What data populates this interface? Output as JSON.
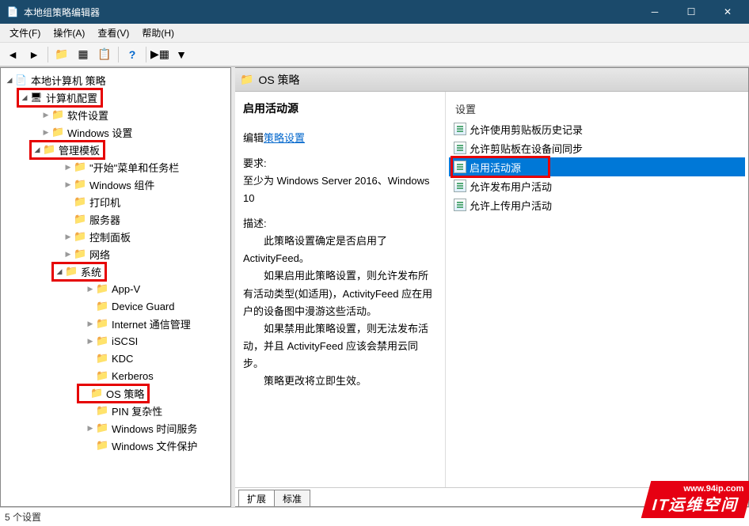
{
  "window": {
    "title": "本地组策略编辑器"
  },
  "menu": {
    "file": "文件(F)",
    "action": "操作(A)",
    "view": "查看(V)",
    "help": "帮助(H)"
  },
  "tree": {
    "root": "本地计算机 策略",
    "computer_config": "计算机配置",
    "software_settings": "软件设置",
    "windows_settings": "Windows 设置",
    "admin_templates": "管理模板",
    "start_menu": "\"开始\"菜单和任务栏",
    "windows_components": "Windows 组件",
    "printers": "打印机",
    "servers": "服务器",
    "control_panel": "控制面板",
    "network": "网络",
    "system": "系统",
    "appv": "App-V",
    "device_guard": "Device Guard",
    "internet_comm": "Internet 通信管理",
    "iscsi": "iSCSI",
    "kdc": "KDC",
    "kerberos": "Kerberos",
    "os_policy": "OS 策略",
    "pin_complexity": "PIN 复杂性",
    "win_time": "Windows 时间服务",
    "win_file_protect": "Windows 文件保护"
  },
  "detail": {
    "header": "OS 策略",
    "title": "启用活动源",
    "edit_label": "编辑",
    "edit_link": "策略设置",
    "requirements_label": "要求:",
    "requirements_text": "至少为 Windows Server 2016、Windows 10",
    "description_label": "描述:",
    "desc_p1": "此策略设置确定是否启用了ActivityFeed。",
    "desc_p2": "如果启用此策略设置，则允许发布所有活动类型(如适用)，ActivityFeed 应在用户的设备图中漫游这些活动。",
    "desc_p3": "如果禁用此策略设置，则无法发布活动，并且 ActivityFeed 应该会禁用云同步。",
    "desc_p4": "策略更改将立即生效。"
  },
  "settings": {
    "header": "设置",
    "items": [
      "允许使用剪贴板历史记录",
      "允许剪贴板在设备间同步",
      "启用活动源",
      "允许发布用户活动",
      "允许上传用户活动"
    ]
  },
  "tabs": {
    "extended": "扩展",
    "standard": "标准"
  },
  "status": "5 个设置",
  "watermark": {
    "url": "www.94ip.com",
    "text": "IT运维空间"
  }
}
